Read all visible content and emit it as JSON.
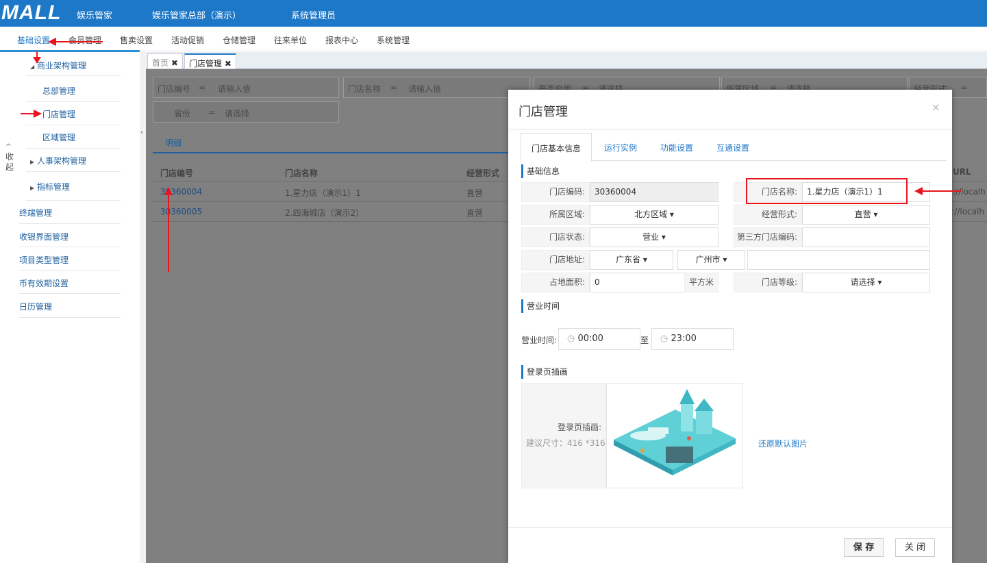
{
  "header": {
    "logo": "MALL",
    "logo_sub": "娱乐管家",
    "hq": "娱乐管家总部（演示）",
    "admin": "系统管理员"
  },
  "menu": [
    "基础设置",
    "会员管理",
    "售卖设置",
    "活动促销",
    "仓储管理",
    "往来单位",
    "报表中心",
    "系统管理"
  ],
  "sidebar": {
    "collapse": "收起",
    "items": [
      "商业架构管理",
      "总部管理",
      "门店管理",
      "区域管理",
      "人事架构管理",
      "指标管理",
      "终端管理",
      "收银界面管理",
      "项目类型管理",
      "币有效期设置",
      "日历管理"
    ]
  },
  "tabs": {
    "home": "首页",
    "store": "门店管理"
  },
  "filters": {
    "store_code": "门店编号",
    "store_name": "门店名称",
    "approx": "≈",
    "eq": "=",
    "placeholder": "请输入值",
    "enabled": "是否启用",
    "select": "请选择",
    "region": "所属区域",
    "biz": "经营形式",
    "province": "省份"
  },
  "grid": {
    "detail_tab": "明细",
    "col_code": "门店编号",
    "col_name": "门店名称",
    "col_biz": "经营形式",
    "col_url": "URL",
    "rows": [
      {
        "code": "30360004",
        "name": "1.星力店（演示1）1",
        "biz": "直营",
        "url": "://localh"
      },
      {
        "code": "30360005",
        "name": "2.四海城店（演示2）",
        "biz": "直营",
        "url": "s://localh"
      }
    ]
  },
  "modal": {
    "title": "门店管理",
    "close": "×",
    "tabs": [
      "门店基本信息",
      "运行实例",
      "功能设置",
      "互通设置"
    ],
    "sec_basic": "基础信息",
    "code_label": "门店编码:",
    "code": "30360004",
    "name_label": "门店名称:",
    "name": "1.星力店（演示1）1",
    "region_label": "所属区域:",
    "region": "北方区域",
    "biz_label": "经营形式:",
    "biz": "直营",
    "status_label": "门店状态:",
    "status": "营业",
    "third_label": "第三方门店编码:",
    "addr_label": "门店地址:",
    "province": "广东省",
    "city": "广州市",
    "area_label": "占地面积:",
    "area": "0",
    "area_unit": "平方米",
    "grade_label": "门店等级:",
    "grade": "请选择",
    "sec_hours": "营业时间",
    "hours_label": "营业时间:",
    "open": "00:00",
    "to": "至",
    "close_time": "23:00",
    "sec_login": "登录页插画",
    "login_label": "登录页插画:",
    "login_hint": "建议尺寸：416 *316",
    "restore": "还原默认图片",
    "save": "保 存",
    "close_btn": "关 闭"
  },
  "colors": {
    "brand": "#1e78c8",
    "annotation": "#e8141e"
  }
}
